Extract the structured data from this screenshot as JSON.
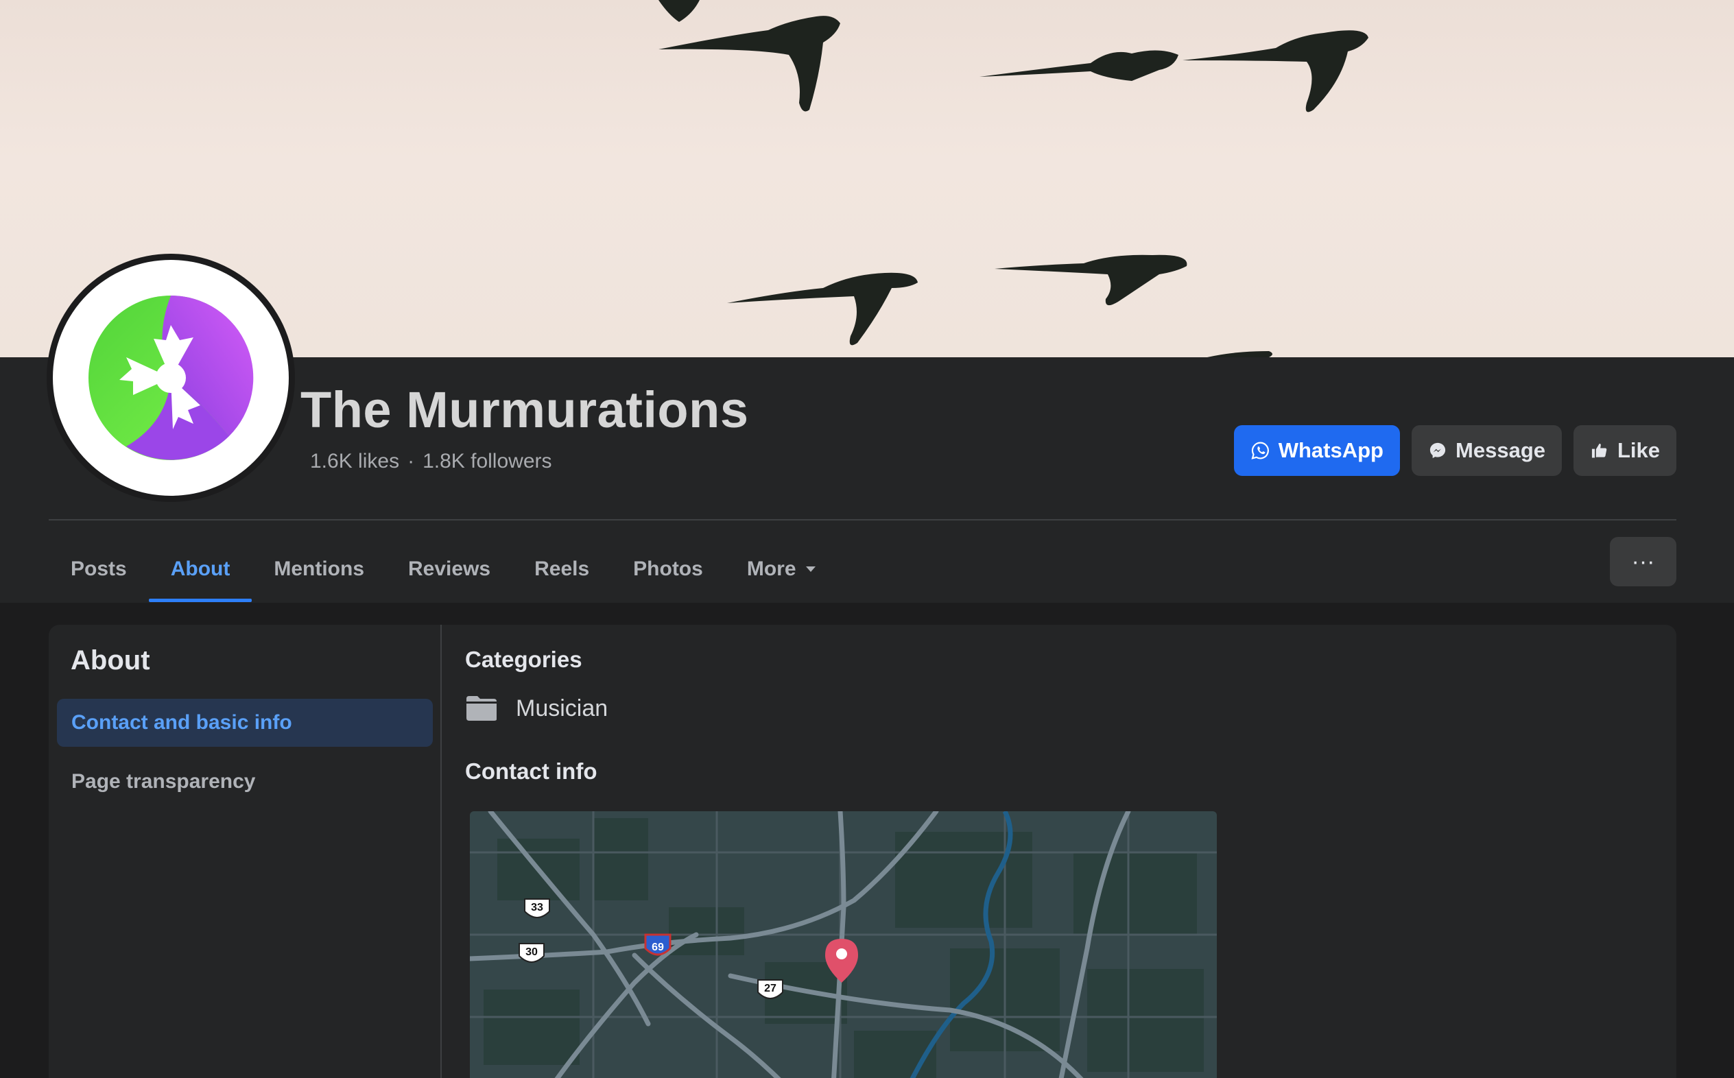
{
  "page": {
    "name": "The Murmurations",
    "likes": "1.6K likes",
    "separator": "·",
    "followers": "1.8K followers"
  },
  "actions": {
    "whatsapp": "WhatsApp",
    "message": "Message",
    "like": "Like"
  },
  "tabs": [
    "Posts",
    "About",
    "Mentions",
    "Reviews",
    "Reels",
    "Photos",
    "More"
  ],
  "more_menu": "···",
  "about": {
    "title": "About",
    "side_items": [
      "Contact and basic info",
      "Page transparency"
    ],
    "categories_heading": "Categories",
    "category": "Musician",
    "contact_heading": "Contact info"
  },
  "map": {
    "shields": [
      "33",
      "30",
      "69",
      "27"
    ]
  },
  "colors": {
    "accent": "#1f6af0",
    "active_tab": "#5aa0f7",
    "panel": "#242526",
    "background": "#1c1c1d"
  }
}
